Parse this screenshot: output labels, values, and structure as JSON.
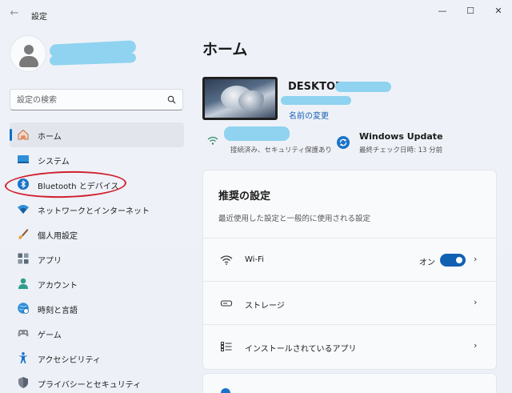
{
  "window": {
    "title": "設定",
    "back_icon": "back-arrow-icon",
    "controls": {
      "minimize": "—",
      "maximize": "☐",
      "close": "✕"
    }
  },
  "sidebar": {
    "search": {
      "placeholder": "設定の検索"
    },
    "items": [
      {
        "label": "ホーム",
        "icon": "home-icon",
        "active": true
      },
      {
        "label": "システム",
        "icon": "system-icon",
        "active": false
      },
      {
        "label": "Bluetooth とデバイス",
        "icon": "bluetooth-icon",
        "active": false
      },
      {
        "label": "ネットワークとインターネット",
        "icon": "network-icon",
        "active": false
      },
      {
        "label": "個人用設定",
        "icon": "personalization-brush-icon",
        "active": false
      },
      {
        "label": "アプリ",
        "icon": "apps-icon",
        "active": false
      },
      {
        "label": "アカウント",
        "icon": "account-icon",
        "active": false
      },
      {
        "label": "時刻と言語",
        "icon": "time-language-icon",
        "active": false
      },
      {
        "label": "ゲーム",
        "icon": "gaming-icon",
        "active": false
      },
      {
        "label": "アクセシビリティ",
        "icon": "accessibility-icon",
        "active": false
      },
      {
        "label": "プライバシーとセキュリティ",
        "icon": "privacy-shield-icon",
        "active": false
      }
    ]
  },
  "main": {
    "title": "ホーム",
    "device": {
      "name": "DESKTOP",
      "rename_label": "名前の変更"
    },
    "network_status": "接続済み、セキュリティ保護あり",
    "windows_update": {
      "title": "Windows Update",
      "subtitle": "最終チェック日時: 13 分前"
    },
    "recommended": {
      "title": "推奨の設定",
      "subtitle": "最近使用した設定と一般的に使用される設定",
      "rows": [
        {
          "label": "Wi-Fi",
          "icon": "wifi-icon",
          "toggle_state": "オン",
          "toggle_on": true
        },
        {
          "label": "ストレージ",
          "icon": "storage-icon"
        },
        {
          "label": "インストールされているアプリ",
          "icon": "installed-apps-icon"
        }
      ],
      "chevron": "›"
    }
  },
  "colors": {
    "accent": "#1161b3",
    "annotation_red": "#d0202e",
    "redaction": "#8fd3f0"
  }
}
